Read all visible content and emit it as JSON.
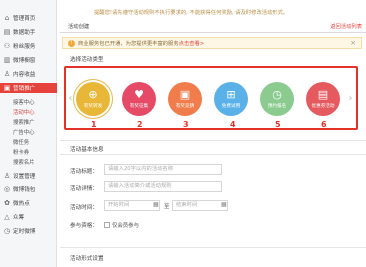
{
  "sidebar": {
    "items": [
      {
        "icon": "⌂",
        "label": "管理首页"
      },
      {
        "icon": "▤",
        "label": "数据助手"
      },
      {
        "icon": "⚇",
        "label": "粉丝服务"
      },
      {
        "icon": "▥",
        "label": "微博橱窗"
      },
      {
        "icon": "♙",
        "label": "内容收益"
      },
      {
        "icon": "▣",
        "label": "营销推广"
      }
    ],
    "subitems": [
      "接客中心",
      "活动中心",
      "搜索推广",
      "广告中心",
      "微任务",
      "粉卡券",
      "搜索名片"
    ],
    "bottom": [
      {
        "icon": "♙",
        "label": "设置管理"
      },
      {
        "icon": "◎",
        "label": "微博钱包"
      },
      {
        "icon": "✿",
        "label": "微热点"
      },
      {
        "icon": "△",
        "label": "众筹"
      },
      {
        "icon": "◷",
        "label": "定时微博"
      }
    ]
  },
  "notice": "提醒您!请先遵守活动规则不执行要求的, 不能获得任何奖励, 请及时修改活动形式。",
  "header": {
    "title": "活动创建",
    "right": "返回活动列表"
  },
  "warning": {
    "text": "商业服务包已开通，为您提供更丰富的服务",
    "link": "点击查看>"
  },
  "select_title": "选择活动类型",
  "templates": [
    {
      "label": "有奖转发",
      "icon": "⊕",
      "color": "#e8b737",
      "num": "1"
    },
    {
      "label": "有奖征集",
      "icon": "♥",
      "color": "#e54a66",
      "num": "2"
    },
    {
      "label": "有奖竞猜",
      "icon": "▣",
      "color": "#f07d4b",
      "num": "3"
    },
    {
      "label": "免费试用",
      "icon": "⊞",
      "color": "#5ab1e8",
      "num": "4"
    },
    {
      "label": "预约报名",
      "icon": "◷",
      "color": "#8bcb8f",
      "num": "5"
    },
    {
      "label": "优惠券活动",
      "icon": "▤",
      "color": "#e45a5e",
      "num": "6"
    }
  ],
  "basic": {
    "title": "活动基本信息",
    "name_label": "活动标题：",
    "name_placeholder": "请输入20字以内的活动名称",
    "desc_label": "活动详情：",
    "desc_placeholder": "请输入活动简介或活动规则",
    "time_label": "活动时间：",
    "start_placeholder": "开始时间",
    "end_placeholder": "结束时间",
    "time_sep": "至",
    "qual_label": "参与资格：",
    "qual_option": "仅会员参与"
  },
  "form_section_title": "活动形式设置"
}
